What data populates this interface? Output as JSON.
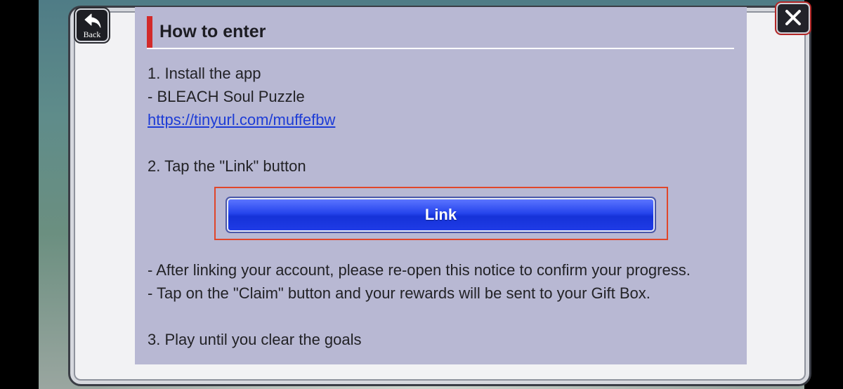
{
  "header": {
    "back_label": "Back",
    "back_icon": "back-arrow-icon",
    "close_icon": "close-x-icon"
  },
  "notice": {
    "heading": "How to enter",
    "step1_title": "1. Install the app",
    "step1_app": "- BLEACH Soul Puzzle",
    "step1_url": "https://tinyurl.com/muffefbw",
    "step2_title": "2. Tap the \"Link\" button",
    "link_button_label": "Link",
    "note1": "- After linking your account, please re-open this notice to confirm your progress.",
    "note2": "- Tap on the \"Claim\" button and your rewards will be sent to your Gift Box.",
    "step3_title": "3. Play until you clear the goals"
  },
  "colors": {
    "panel_bg": "#b8b8d3",
    "heading_accent": "#d22a2a",
    "button_blue": "#2544ec",
    "highlight_border": "#e0462a",
    "url_color": "#1d3cd6"
  }
}
